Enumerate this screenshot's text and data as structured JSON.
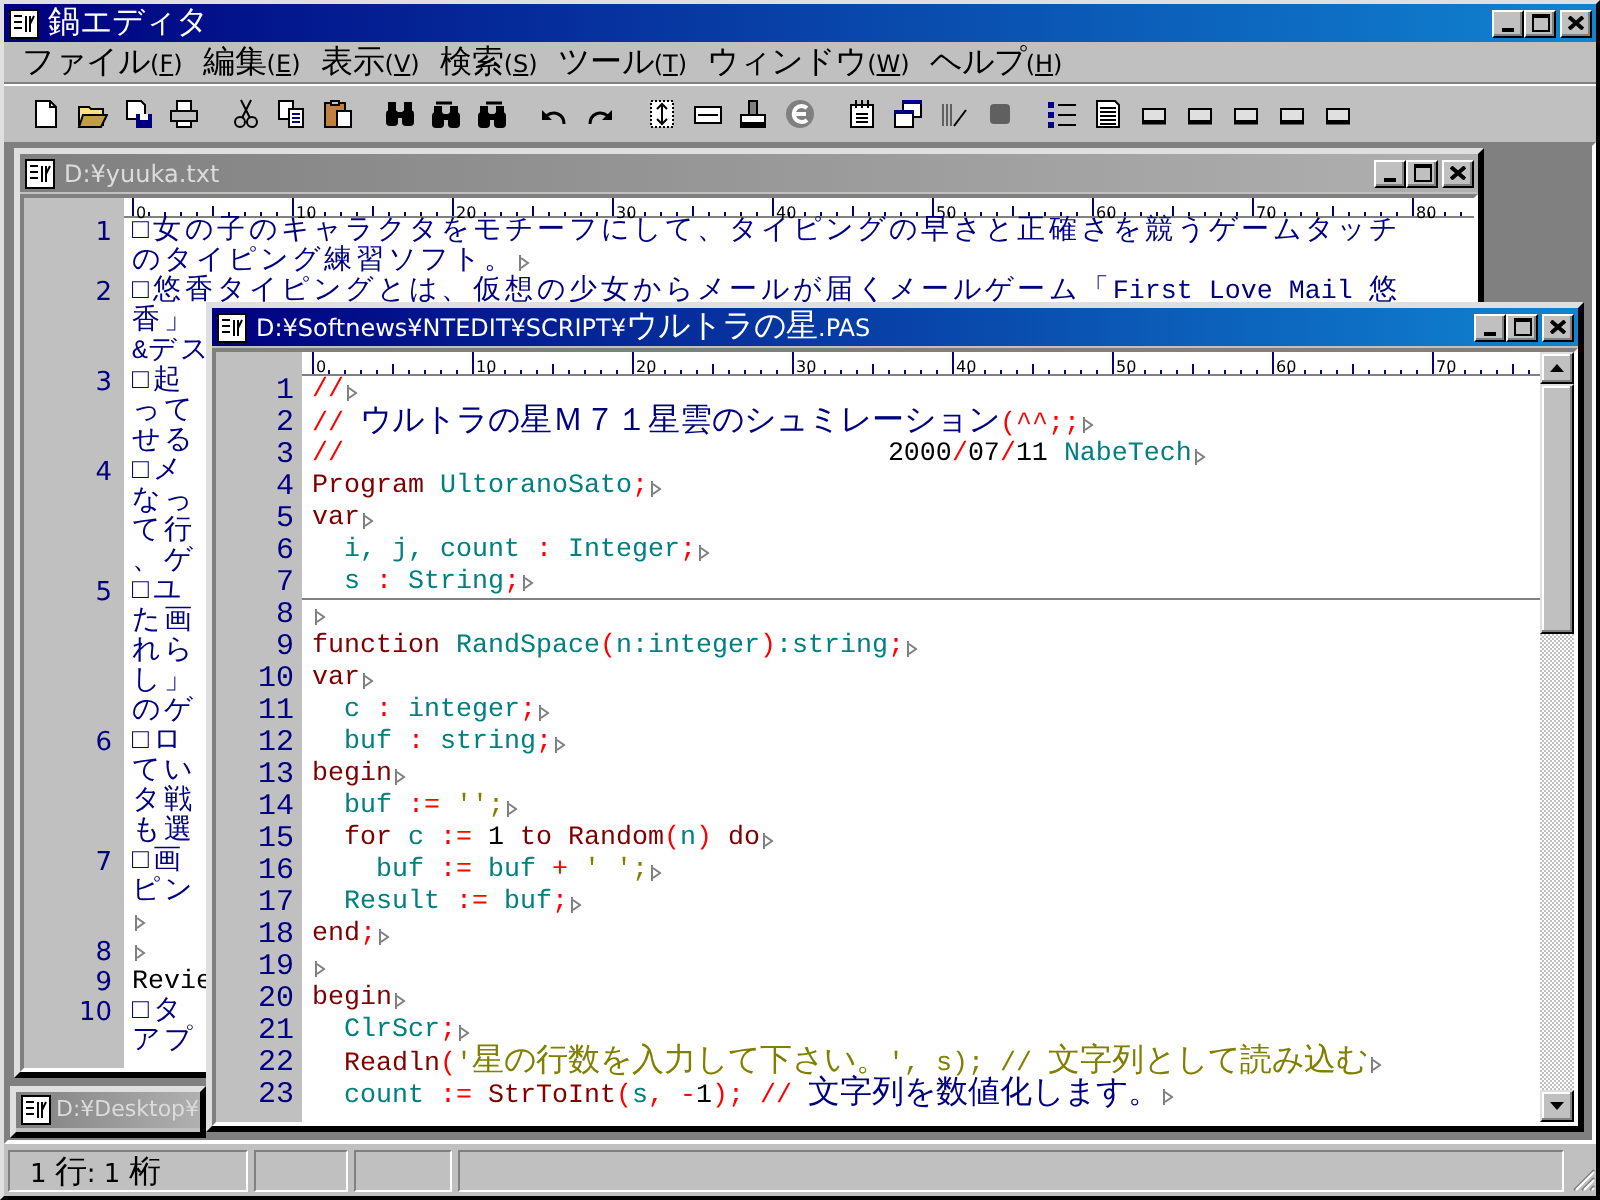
{
  "app": {
    "title": "鍋エディタ"
  },
  "menu": [
    {
      "before": "ファイル(",
      "mnemonic": "F",
      "after": ")"
    },
    {
      "before": "編集(",
      "mnemonic": "E",
      "after": ")"
    },
    {
      "before": "表示(",
      "mnemonic": "V",
      "after": ")"
    },
    {
      "before": "検索(",
      "mnemonic": "S",
      "after": ")"
    },
    {
      "before": "ツール(",
      "mnemonic": "T",
      "after": ")"
    },
    {
      "before": "ウィンドウ(",
      "mnemonic": "W",
      "after": ")"
    },
    {
      "before": "ヘルプ(",
      "mnemonic": "H",
      "after": ")"
    }
  ],
  "documents": [
    {
      "kind": "text",
      "title": "D:¥yuuka.txt",
      "active": false,
      "ruler": [
        "0",
        "10",
        "20",
        "30",
        "40",
        "50",
        "60",
        "70",
        "80"
      ],
      "lines": [
        {
          "number": "1",
          "rows": [
            "□女の子のキャラクタをモチーフにして、タイピングの早さと正確さを競うゲームタッチ",
            "のタイピング練習ソフト。"
          ],
          "eol": true,
          "color": "#000080"
        },
        {
          "number": "2",
          "rows": [
            "□悠香タイピングとは、仮想の少女からメールが届くメールゲーム「First Love Mail 悠",
            "香」",
            "&デス"
          ],
          "eol": false,
          "color": "#000080"
        },
        {
          "number": "3",
          "rows": [
            "□起",
            "って",
            "せる"
          ],
          "eol": false,
          "color": "#000080"
        },
        {
          "number": "4",
          "rows": [
            "□メ",
            "なっ",
            "て行",
            "、ゲ"
          ],
          "eol": false,
          "color": "#000080"
        },
        {
          "number": "5",
          "rows": [
            "□ユ",
            "た画",
            "れら",
            "し」",
            "のゲ"
          ],
          "eol": false,
          "color": "#000080"
        },
        {
          "number": "6",
          "rows": [
            "□ロ",
            "てい",
            "タ戦",
            "も選"
          ],
          "eol": false,
          "color": "#000080"
        },
        {
          "number": "7",
          "rows": [
            "□画",
            "ピン"
          ],
          "eol": true,
          "eol_own_row": true,
          "color": "#000080"
        },
        {
          "number": "8",
          "eol": true
        },
        {
          "number": "9",
          "rows": [
            "Revie"
          ],
          "eol": false,
          "color": "#000000"
        },
        {
          "number": "10",
          "rows": [
            "□タ",
            "アプ"
          ],
          "eol": false,
          "color": "#000080"
        }
      ]
    },
    {
      "kind": "code",
      "title": "D:¥Softnews¥NTEDIT¥SCRIPT¥ウルトラの星.PAS",
      "active": true,
      "ruler": [
        "0",
        "10",
        "20",
        "30",
        "40",
        "50",
        "60",
        "70"
      ],
      "lines": [
        {
          "number": "1",
          "eol": true,
          "tokens": [
            {
              "kind": "symbol",
              "text": "//"
            }
          ]
        },
        {
          "number": "2",
          "eol": true,
          "tokens": [
            {
              "kind": "symbol",
              "text": "//"
            },
            {
              "kind": "comment",
              "text": " ウルトラの星Ｍ７１星雲のシュミレーション"
            },
            {
              "kind": "symbol",
              "text": "(^^;;"
            }
          ]
        },
        {
          "number": "3",
          "eol": true,
          "tokens": [
            {
              "kind": "symbol",
              "text": "//"
            },
            {
              "kind": "number",
              "text": "                                  2000"
            },
            {
              "kind": "symbol",
              "text": "/"
            },
            {
              "kind": "number",
              "text": "07"
            },
            {
              "kind": "symbol",
              "text": "/"
            },
            {
              "kind": "number",
              "text": "11 "
            },
            {
              "kind": "identifier",
              "text": "NabeTech"
            }
          ]
        },
        {
          "number": "4",
          "eol": true,
          "tokens": [
            {
              "kind": "reserved",
              "text": "Program "
            },
            {
              "kind": "identifier",
              "text": "UltoranoSato"
            },
            {
              "kind": "symbol",
              "text": ";"
            }
          ]
        },
        {
          "number": "5",
          "eol": true,
          "tokens": [
            {
              "kind": "reserved",
              "text": "var"
            }
          ]
        },
        {
          "number": "6",
          "eol": true,
          "tokens": [
            {
              "kind": "identifier",
              "text": "  i, j, count "
            },
            {
              "kind": "symbol",
              "text": ":"
            },
            {
              "kind": "identifier",
              "text": " Integer"
            },
            {
              "kind": "symbol",
              "text": ";"
            }
          ]
        },
        {
          "number": "7",
          "eol": true,
          "rule_below": true,
          "tokens": [
            {
              "kind": "identifier",
              "text": "  s "
            },
            {
              "kind": "symbol",
              "text": ":"
            },
            {
              "kind": "identifier",
              "text": " String"
            },
            {
              "kind": "symbol",
              "text": ";"
            }
          ]
        },
        {
          "number": "8",
          "eol": true
        },
        {
          "number": "9",
          "eol": true,
          "tokens": [
            {
              "kind": "reserved",
              "text": "function "
            },
            {
              "kind": "identifier",
              "text": "RandSpace"
            },
            {
              "kind": "symbol",
              "text": "("
            },
            {
              "kind": "identifier",
              "text": "n:integer"
            },
            {
              "kind": "symbol",
              "text": ")"
            },
            {
              "kind": "identifier",
              "text": ":string"
            },
            {
              "kind": "symbol",
              "text": ";"
            }
          ]
        },
        {
          "number": "10",
          "eol": true,
          "tokens": [
            {
              "kind": "reserved",
              "text": "var"
            }
          ]
        },
        {
          "number": "11",
          "eol": true,
          "tokens": [
            {
              "kind": "identifier",
              "text": "  c "
            },
            {
              "kind": "symbol",
              "text": ":"
            },
            {
              "kind": "identifier",
              "text": " integer"
            },
            {
              "kind": "symbol",
              "text": ";"
            }
          ]
        },
        {
          "number": "12",
          "eol": true,
          "tokens": [
            {
              "kind": "identifier",
              "text": "  buf "
            },
            {
              "kind": "symbol",
              "text": ":"
            },
            {
              "kind": "identifier",
              "text": " string"
            },
            {
              "kind": "symbol",
              "text": ";"
            }
          ]
        },
        {
          "number": "13",
          "eol": true,
          "tokens": [
            {
              "kind": "reserved",
              "text": "begin"
            }
          ]
        },
        {
          "number": "14",
          "eol": true,
          "tokens": [
            {
              "kind": "identifier",
              "text": "  buf "
            },
            {
              "kind": "symbol",
              "text": ":="
            },
            {
              "kind": "string",
              "text": " '';"
            }
          ]
        },
        {
          "number": "15",
          "eol": true,
          "tokens": [
            {
              "kind": "reserved",
              "text": "  for "
            },
            {
              "kind": "identifier",
              "text": "c "
            },
            {
              "kind": "symbol",
              "text": ":="
            },
            {
              "kind": "number",
              "text": " 1 "
            },
            {
              "kind": "reserved",
              "text": "to Random"
            },
            {
              "kind": "symbol",
              "text": "("
            },
            {
              "kind": "identifier",
              "text": "n"
            },
            {
              "kind": "symbol",
              "text": ")"
            },
            {
              "kind": "reserved",
              "text": " do"
            }
          ]
        },
        {
          "number": "16",
          "eol": true,
          "tokens": [
            {
              "kind": "identifier",
              "text": "    buf "
            },
            {
              "kind": "symbol",
              "text": ":="
            },
            {
              "kind": "identifier",
              "text": " buf "
            },
            {
              "kind": "symbol",
              "text": "+"
            },
            {
              "kind": "string",
              "text": " ' ';"
            }
          ]
        },
        {
          "number": "17",
          "eol": true,
          "tokens": [
            {
              "kind": "identifier",
              "text": "  Result "
            },
            {
              "kind": "symbol",
              "text": ":="
            },
            {
              "kind": "identifier",
              "text": " buf"
            },
            {
              "kind": "symbol",
              "text": ";"
            }
          ]
        },
        {
          "number": "18",
          "eol": true,
          "tokens": [
            {
              "kind": "reserved",
              "text": "end"
            },
            {
              "kind": "symbol",
              "text": ";"
            }
          ]
        },
        {
          "number": "19",
          "eol": true
        },
        {
          "number": "20",
          "eol": true,
          "tokens": [
            {
              "kind": "reserved",
              "text": "begin"
            }
          ]
        },
        {
          "number": "21",
          "eol": true,
          "tokens": [
            {
              "kind": "identifier",
              "text": "  ClrScr"
            },
            {
              "kind": "symbol",
              "text": ";"
            }
          ]
        },
        {
          "number": "22",
          "eol": true,
          "tokens": [
            {
              "kind": "reserved",
              "text": "  Readln"
            },
            {
              "kind": "symbol",
              "text": "("
            },
            {
              "kind": "string",
              "text": "'星の行数を入力して下さい。', s); // 文字列として読み込む"
            }
          ]
        },
        {
          "number": "23",
          "eol": true,
          "tokens": [
            {
              "kind": "identifier",
              "text": "  count "
            },
            {
              "kind": "symbol",
              "text": ":="
            },
            {
              "kind": "reserved",
              "text": " StrToInt"
            },
            {
              "kind": "symbol",
              "text": "("
            },
            {
              "kind": "identifier",
              "text": "s"
            },
            {
              "kind": "symbol",
              "text": ", -"
            },
            {
              "kind": "number",
              "text": "1"
            },
            {
              "kind": "symbol",
              "text": "); //"
            },
            {
              "kind": "comment",
              "text": " 文字列を数値化します。"
            }
          ]
        }
      ]
    }
  ],
  "minimized": [
    {
      "title": "D:¥Desktop¥",
      "active": false
    }
  ],
  "status_bar": {
    "position": "1 行: 1 桁"
  }
}
